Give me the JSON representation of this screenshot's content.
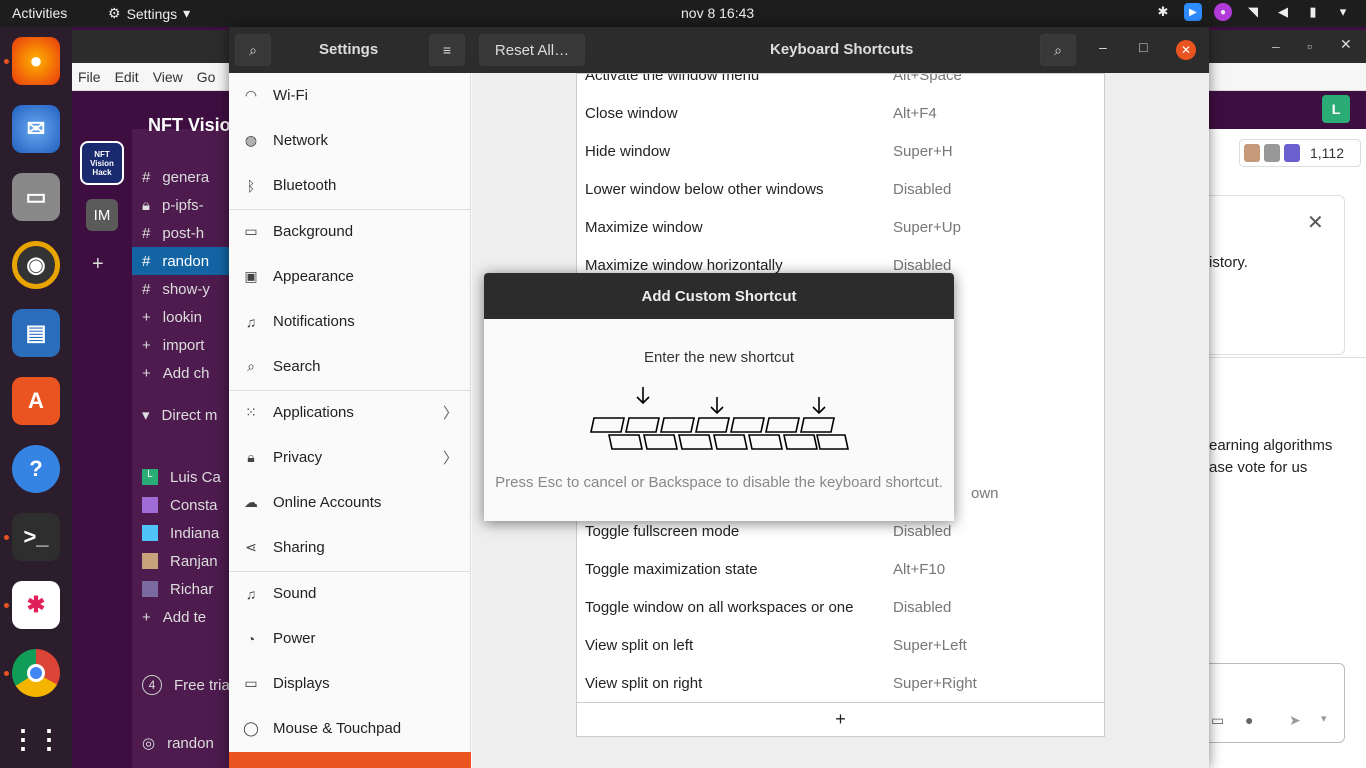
{
  "topbar": {
    "activities": "Activities",
    "app_name": "Settings",
    "clock": "nov 8  16:43"
  },
  "slack": {
    "menu": [
      "File",
      "Edit",
      "View",
      "Go"
    ],
    "workspace_name": "NFT Visio",
    "workspace_badge": "IM",
    "channels": [
      "genera",
      "p-ipfs-",
      "post-h",
      "randon",
      "show-y",
      "lookin",
      "import",
      "Add ch"
    ],
    "dm_header": "Direct m",
    "dms": [
      "Luis Ca",
      "Consta",
      "Indiana",
      "Ranjan",
      "Richar",
      "Add te"
    ],
    "free_trial_count": "4",
    "free_trial": "Free tria",
    "footer_channel": "randon",
    "member_count": "1,112",
    "avatar_letter": "L",
    "msg_fragment_1": "istory.",
    "msg_fragment_2": "earning algorithms",
    "msg_fragment_3": "ase vote for us"
  },
  "settings": {
    "title": "Settings",
    "reset_label": "Reset All…",
    "panel_title": "Keyboard Shortcuts",
    "nav": [
      {
        "label": "Wi-Fi",
        "icon": "wifi-icon"
      },
      {
        "label": "Network",
        "icon": "network-icon"
      },
      {
        "label": "Bluetooth",
        "icon": "bluetooth-icon"
      },
      {
        "label": "Background",
        "icon": "background-icon"
      },
      {
        "label": "Appearance",
        "icon": "appearance-icon"
      },
      {
        "label": "Notifications",
        "icon": "bell-icon"
      },
      {
        "label": "Search",
        "icon": "search-icon"
      },
      {
        "label": "Applications",
        "icon": "apps-icon"
      },
      {
        "label": "Privacy",
        "icon": "lock-icon"
      },
      {
        "label": "Online Accounts",
        "icon": "cloud-icon"
      },
      {
        "label": "Sharing",
        "icon": "share-icon"
      },
      {
        "label": "Sound",
        "icon": "music-icon"
      },
      {
        "label": "Power",
        "icon": "power-icon"
      },
      {
        "label": "Displays",
        "icon": "display-icon"
      },
      {
        "label": "Mouse & Touchpad",
        "icon": "mouse-icon"
      }
    ],
    "shortcuts": [
      {
        "name": "Activate the window menu",
        "key": "Alt+Space"
      },
      {
        "name": "Close window",
        "key": "Alt+F4"
      },
      {
        "name": "Hide window",
        "key": "Super+H"
      },
      {
        "name": "Lower window below other windows",
        "key": "Disabled"
      },
      {
        "name": "Maximize window",
        "key": "Super+Up"
      },
      {
        "name": "Maximize window horizontally",
        "key": "Disabled"
      },
      {
        "name": "",
        "key": ""
      },
      {
        "name": "",
        "key": ""
      },
      {
        "name": "",
        "key": ""
      },
      {
        "name": "",
        "key": ""
      },
      {
        "name": "",
        "key": "own"
      },
      {
        "name": "Toggle fullscreen mode",
        "key": "Disabled"
      },
      {
        "name": "Toggle maximization state",
        "key": "Alt+F10"
      },
      {
        "name": "Toggle window on all workspaces or one",
        "key": "Disabled"
      },
      {
        "name": "View split on left",
        "key": "Super+Left"
      },
      {
        "name": "View split on right",
        "key": "Super+Right"
      }
    ],
    "add_symbol": "+"
  },
  "dialog": {
    "title": "Add Custom Shortcut",
    "prompt": "Enter the new shortcut",
    "hint": "Press Esc to cancel or Backspace to disable the keyboard shortcut."
  },
  "colors": {
    "accent": "#e95420",
    "slack_purple": "#3f0e40",
    "header_dark": "#2c2c2c"
  }
}
